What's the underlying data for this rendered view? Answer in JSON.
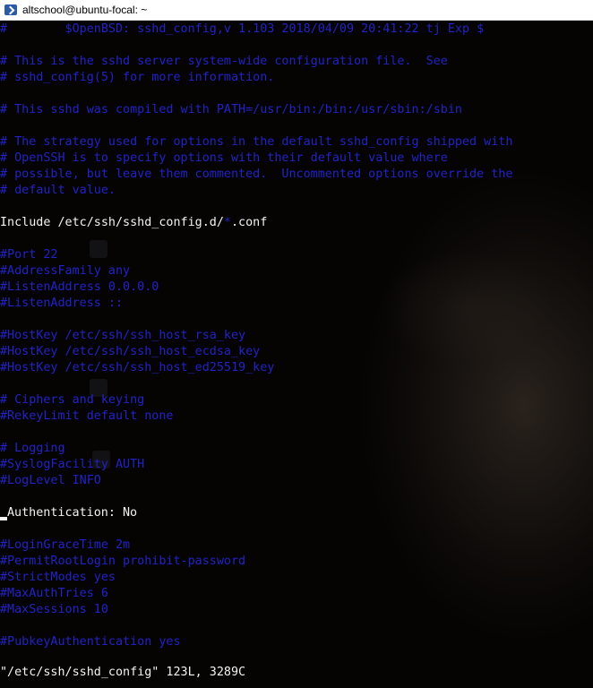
{
  "window": {
    "title": "altschool@ubuntu-focal: ~",
    "icon": "powershell-icon"
  },
  "colors": {
    "comment": "#2222c8",
    "normal": "#f2f2f2",
    "background": "#050403",
    "titlebar": "#ffffff"
  },
  "editor": {
    "lines": [
      {
        "text": "#\t$OpenBSD: sshd_config,v 1.103 2018/04/09 20:41:22 tj Exp $",
        "kind": "comment"
      },
      {
        "text": "",
        "kind": "blank"
      },
      {
        "text": "# This is the sshd server system-wide configuration file.  See",
        "kind": "comment"
      },
      {
        "text": "# sshd_config(5) for more information.",
        "kind": "comment"
      },
      {
        "text": "",
        "kind": "blank"
      },
      {
        "text": "# This sshd was compiled with PATH=/usr/bin:/bin:/usr/sbin:/sbin",
        "kind": "comment"
      },
      {
        "text": "",
        "kind": "blank"
      },
      {
        "text": "# The strategy used for options in the default sshd_config shipped with",
        "kind": "comment"
      },
      {
        "text": "# OpenSSH is to specify options with their default value where",
        "kind": "comment"
      },
      {
        "text": "# possible, but leave them commented.  Uncommented options override the",
        "kind": "comment"
      },
      {
        "text": "# default value.",
        "kind": "comment"
      },
      {
        "text": "",
        "kind": "blank"
      },
      {
        "text_a": "Include /etc/ssh/sshd_config.d/",
        "text_b": "*",
        "text_c": ".conf",
        "kind": "include"
      },
      {
        "text": "",
        "kind": "blank"
      },
      {
        "text": "#Port 22",
        "kind": "comment"
      },
      {
        "text": "#AddressFamily any",
        "kind": "comment"
      },
      {
        "text": "#ListenAddress 0.0.0.0",
        "kind": "comment"
      },
      {
        "text": "#ListenAddress ::",
        "kind": "comment"
      },
      {
        "text": "",
        "kind": "blank"
      },
      {
        "text": "#HostKey /etc/ssh/ssh_host_rsa_key",
        "kind": "comment"
      },
      {
        "text": "#HostKey /etc/ssh/ssh_host_ecdsa_key",
        "kind": "comment"
      },
      {
        "text": "#HostKey /etc/ssh/ssh_host_ed25519_key",
        "kind": "comment"
      },
      {
        "text": "",
        "kind": "blank"
      },
      {
        "text": "# Ciphers and keying",
        "kind": "comment"
      },
      {
        "text": "#RekeyLimit default none",
        "kind": "comment"
      },
      {
        "text": "",
        "kind": "blank"
      },
      {
        "text": "# Logging",
        "kind": "comment"
      },
      {
        "text": "#SyslogFacility AUTH",
        "kind": "comment"
      },
      {
        "text": "#LogLevel INFO",
        "kind": "comment"
      },
      {
        "text": "",
        "kind": "blank"
      },
      {
        "text": "Authentication: No",
        "kind": "cursorline"
      },
      {
        "text": "",
        "kind": "blank"
      },
      {
        "text": "#LoginGraceTime 2m",
        "kind": "comment"
      },
      {
        "text": "#PermitRootLogin prohibit-password",
        "kind": "comment"
      },
      {
        "text": "#StrictModes yes",
        "kind": "comment"
      },
      {
        "text": "#MaxAuthTries 6",
        "kind": "comment"
      },
      {
        "text": "#MaxSessions 10",
        "kind": "comment"
      },
      {
        "text": "",
        "kind": "blank"
      },
      {
        "text": "#PubkeyAuthentication yes",
        "kind": "comment"
      },
      {
        "text": "",
        "kind": "blank"
      }
    ],
    "status": "\"/etc/ssh/sshd_config\" 123L, 3289C"
  }
}
